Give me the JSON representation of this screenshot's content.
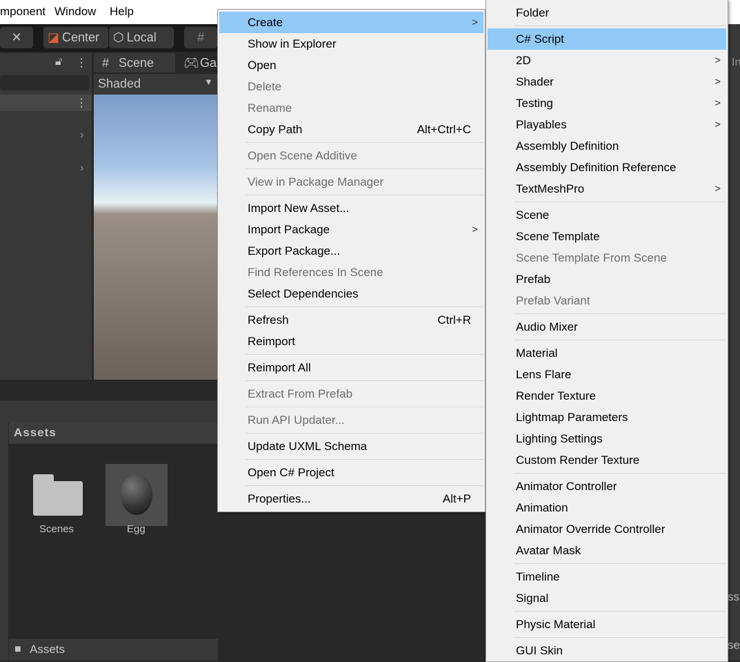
{
  "menubar": {
    "items": [
      "mponent",
      "Window",
      "Help"
    ]
  },
  "toolbar": {
    "center": "Center",
    "local": "Local"
  },
  "hierarchy": {},
  "scene": {
    "tab": "Scene",
    "game_tab": "Ga",
    "shading": "Shaded"
  },
  "project": {
    "header": "Assets",
    "assets": [
      {
        "name": "Scenes",
        "icon": "folder-icon"
      },
      {
        "name": "Egg",
        "icon": "material-sphere-icon"
      }
    ],
    "breadcrumb": "Assets"
  },
  "context_menu": [
    {
      "label": "Create",
      "submenu": true,
      "highlight": true
    },
    {
      "label": "Show in Explorer"
    },
    {
      "label": "Open"
    },
    {
      "label": "Delete",
      "disabled": true
    },
    {
      "label": "Rename",
      "disabled": true
    },
    {
      "label": "Copy Path",
      "shortcut": "Alt+Ctrl+C"
    },
    {
      "sep": true
    },
    {
      "label": "Open Scene Additive",
      "disabled": true
    },
    {
      "sep": true
    },
    {
      "label": "View in Package Manager",
      "disabled": true
    },
    {
      "sep": true
    },
    {
      "label": "Import New Asset..."
    },
    {
      "label": "Import Package",
      "submenu": true
    },
    {
      "label": "Export Package..."
    },
    {
      "label": "Find References In Scene",
      "disabled": true
    },
    {
      "label": "Select Dependencies"
    },
    {
      "sep": true
    },
    {
      "label": "Refresh",
      "shortcut": "Ctrl+R"
    },
    {
      "label": "Reimport"
    },
    {
      "sep": true
    },
    {
      "label": "Reimport All"
    },
    {
      "sep": true
    },
    {
      "label": "Extract From Prefab",
      "disabled": true
    },
    {
      "sep": true
    },
    {
      "label": "Run API Updater...",
      "disabled": true
    },
    {
      "sep": true
    },
    {
      "label": "Update UXML Schema"
    },
    {
      "sep": true
    },
    {
      "label": "Open C# Project"
    },
    {
      "sep": true
    },
    {
      "label": "Properties...",
      "shortcut": "Alt+P"
    }
  ],
  "create_submenu": [
    {
      "label": "Folder"
    },
    {
      "sep": true
    },
    {
      "label": "C# Script",
      "highlight": true
    },
    {
      "label": "2D",
      "submenu": true
    },
    {
      "label": "Shader",
      "submenu": true
    },
    {
      "label": "Testing",
      "submenu": true
    },
    {
      "label": "Playables",
      "submenu": true
    },
    {
      "label": "Assembly Definition"
    },
    {
      "label": "Assembly Definition Reference"
    },
    {
      "label": "TextMeshPro",
      "submenu": true
    },
    {
      "sep": true
    },
    {
      "label": "Scene"
    },
    {
      "label": "Scene Template"
    },
    {
      "label": "Scene Template From Scene",
      "disabled": true
    },
    {
      "label": "Prefab"
    },
    {
      "label": "Prefab Variant",
      "disabled": true
    },
    {
      "sep": true
    },
    {
      "label": "Audio Mixer"
    },
    {
      "sep": true
    },
    {
      "label": "Material"
    },
    {
      "label": "Lens Flare"
    },
    {
      "label": "Render Texture"
    },
    {
      "label": "Lightmap Parameters"
    },
    {
      "label": "Lighting Settings"
    },
    {
      "label": "Custom Render Texture"
    },
    {
      "sep": true
    },
    {
      "label": "Animator Controller"
    },
    {
      "label": "Animation"
    },
    {
      "label": "Animator Override Controller"
    },
    {
      "label": "Avatar Mask"
    },
    {
      "sep": true
    },
    {
      "label": "Timeline"
    },
    {
      "label": "Signal"
    },
    {
      "sep": true
    },
    {
      "label": "Physic Material"
    },
    {
      "sep": true
    },
    {
      "label": "GUI Skin"
    }
  ],
  "right_panel": {
    "tab_fragment": "In",
    "text1": "ss",
    "text2": "se"
  },
  "colors": {
    "highlight": "#91c9f7",
    "menu_bg": "#f0f0f0",
    "editor_bg": "#282828"
  }
}
